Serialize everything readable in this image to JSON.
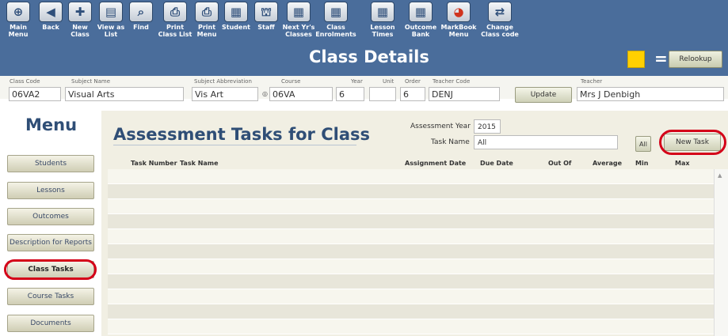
{
  "toolbar": {
    "items": [
      {
        "label": "Main\nMenu",
        "icon": "main-menu-icon",
        "glyph": "⊕"
      },
      {
        "label": "Back",
        "icon": "back-icon",
        "glyph": "◀"
      },
      {
        "label": "New\nClass",
        "icon": "new-class-icon",
        "glyph": "✚"
      },
      {
        "label": "View as\nList",
        "icon": "list-icon",
        "glyph": "▤"
      },
      {
        "label": "Find",
        "icon": "search-icon",
        "glyph": "⌕"
      },
      {
        "label": "Print\nClass List",
        "icon": "print-icon",
        "glyph": "⎙"
      },
      {
        "label": "Print\nMenu",
        "icon": "print-icon",
        "glyph": "⎙"
      },
      {
        "label": "Student",
        "icon": "student-icon",
        "glyph": "▦"
      },
      {
        "label": "Staff",
        "icon": "graduation-cap-icon",
        "glyph": "⛫"
      },
      {
        "label": "Next Yr's\nClasses",
        "icon": "next-year-icon",
        "glyph": "▦"
      },
      {
        "label": "Class\nEnrolments",
        "icon": "enrolments-icon",
        "glyph": "▦"
      },
      {
        "label": "Lesson\nTimes",
        "icon": "lesson-times-icon",
        "glyph": "▦"
      },
      {
        "label": "Outcome\nBank",
        "icon": "outcome-bank-icon",
        "glyph": "▦"
      },
      {
        "label": "MarkBook\nMenu",
        "icon": "pie-chart-icon",
        "glyph": "◕"
      },
      {
        "label": "Change\nClass code",
        "icon": "change-code-icon",
        "glyph": "⇄"
      }
    ]
  },
  "header": {
    "title": "Class Details",
    "relookup_label": "Relookup",
    "equals": "=",
    "swatch_color": "#ffd000"
  },
  "fields": {
    "class_code": {
      "label": "Class Code",
      "value": "06VA2"
    },
    "subject_name": {
      "label": "Subject Name",
      "value": "Visual Arts"
    },
    "subject_abbrev": {
      "label": "Subject Abbreviation",
      "value": "Vis Art"
    },
    "course": {
      "label": "Course",
      "value": "06VA"
    },
    "year": {
      "label": "Year",
      "value": "6"
    },
    "unit": {
      "label": "Unit",
      "value": ""
    },
    "order": {
      "label": "Order",
      "value": "6"
    },
    "teacher_code": {
      "label": "Teacher Code",
      "value": "DENJ"
    },
    "teacher": {
      "label": "Teacher",
      "value": "Mrs J Denbigh"
    },
    "update_label": "Update"
  },
  "sidebar": {
    "heading": "Menu",
    "items": [
      {
        "label": "Students"
      },
      {
        "label": "Lessons"
      },
      {
        "label": "Outcomes"
      },
      {
        "label": "Description for Reports"
      },
      {
        "label": "Class Tasks"
      },
      {
        "label": "Course Tasks"
      },
      {
        "label": "Documents"
      }
    ]
  },
  "main": {
    "title": "Assessment Tasks for Class",
    "assessment_year_label": "Assessment Year",
    "assessment_year_value": "2015",
    "task_name_label": "Task Name",
    "task_name_value": "All",
    "all_label": "All",
    "new_task_label": "New Task",
    "columns": [
      "Task Number",
      "Task Name",
      "Assignment Date",
      "Due Date",
      "Out Of",
      "Average",
      "Min",
      "Max"
    ]
  },
  "colors": {
    "toolbar": "#4a6d9b",
    "highlight_ring": "#d40018",
    "heading": "#2f4e76"
  }
}
